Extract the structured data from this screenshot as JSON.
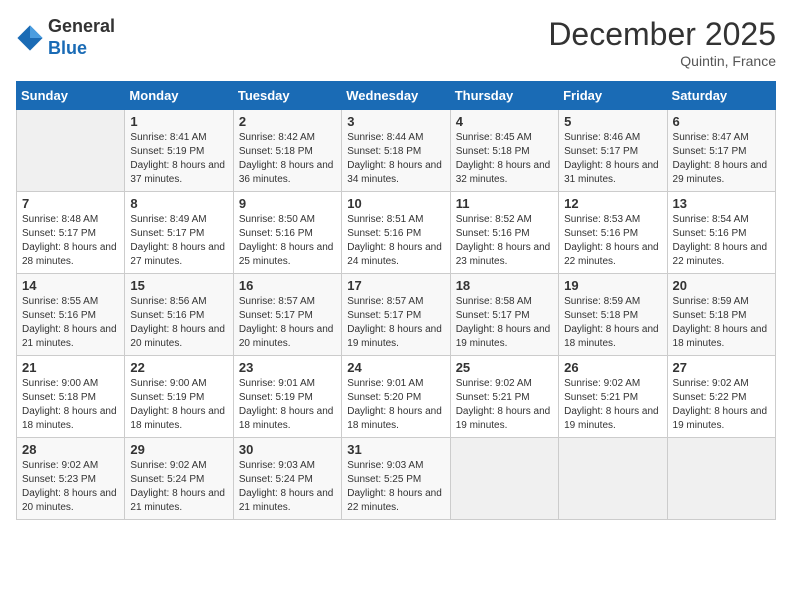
{
  "logo": {
    "general": "General",
    "blue": "Blue"
  },
  "title": {
    "month_year": "December 2025",
    "location": "Quintin, France"
  },
  "days_header": [
    "Sunday",
    "Monday",
    "Tuesday",
    "Wednesday",
    "Thursday",
    "Friday",
    "Saturday"
  ],
  "weeks": [
    [
      {
        "day": "",
        "empty": true
      },
      {
        "day": "1",
        "sunrise": "Sunrise: 8:41 AM",
        "sunset": "Sunset: 5:19 PM",
        "daylight": "Daylight: 8 hours and 37 minutes."
      },
      {
        "day": "2",
        "sunrise": "Sunrise: 8:42 AM",
        "sunset": "Sunset: 5:18 PM",
        "daylight": "Daylight: 8 hours and 36 minutes."
      },
      {
        "day": "3",
        "sunrise": "Sunrise: 8:44 AM",
        "sunset": "Sunset: 5:18 PM",
        "daylight": "Daylight: 8 hours and 34 minutes."
      },
      {
        "day": "4",
        "sunrise": "Sunrise: 8:45 AM",
        "sunset": "Sunset: 5:18 PM",
        "daylight": "Daylight: 8 hours and 32 minutes."
      },
      {
        "day": "5",
        "sunrise": "Sunrise: 8:46 AM",
        "sunset": "Sunset: 5:17 PM",
        "daylight": "Daylight: 8 hours and 31 minutes."
      },
      {
        "day": "6",
        "sunrise": "Sunrise: 8:47 AM",
        "sunset": "Sunset: 5:17 PM",
        "daylight": "Daylight: 8 hours and 29 minutes."
      }
    ],
    [
      {
        "day": "7",
        "sunrise": "Sunrise: 8:48 AM",
        "sunset": "Sunset: 5:17 PM",
        "daylight": "Daylight: 8 hours and 28 minutes."
      },
      {
        "day": "8",
        "sunrise": "Sunrise: 8:49 AM",
        "sunset": "Sunset: 5:17 PM",
        "daylight": "Daylight: 8 hours and 27 minutes."
      },
      {
        "day": "9",
        "sunrise": "Sunrise: 8:50 AM",
        "sunset": "Sunset: 5:16 PM",
        "daylight": "Daylight: 8 hours and 25 minutes."
      },
      {
        "day": "10",
        "sunrise": "Sunrise: 8:51 AM",
        "sunset": "Sunset: 5:16 PM",
        "daylight": "Daylight: 8 hours and 24 minutes."
      },
      {
        "day": "11",
        "sunrise": "Sunrise: 8:52 AM",
        "sunset": "Sunset: 5:16 PM",
        "daylight": "Daylight: 8 hours and 23 minutes."
      },
      {
        "day": "12",
        "sunrise": "Sunrise: 8:53 AM",
        "sunset": "Sunset: 5:16 PM",
        "daylight": "Daylight: 8 hours and 22 minutes."
      },
      {
        "day": "13",
        "sunrise": "Sunrise: 8:54 AM",
        "sunset": "Sunset: 5:16 PM",
        "daylight": "Daylight: 8 hours and 22 minutes."
      }
    ],
    [
      {
        "day": "14",
        "sunrise": "Sunrise: 8:55 AM",
        "sunset": "Sunset: 5:16 PM",
        "daylight": "Daylight: 8 hours and 21 minutes."
      },
      {
        "day": "15",
        "sunrise": "Sunrise: 8:56 AM",
        "sunset": "Sunset: 5:16 PM",
        "daylight": "Daylight: 8 hours and 20 minutes."
      },
      {
        "day": "16",
        "sunrise": "Sunrise: 8:57 AM",
        "sunset": "Sunset: 5:17 PM",
        "daylight": "Daylight: 8 hours and 20 minutes."
      },
      {
        "day": "17",
        "sunrise": "Sunrise: 8:57 AM",
        "sunset": "Sunset: 5:17 PM",
        "daylight": "Daylight: 8 hours and 19 minutes."
      },
      {
        "day": "18",
        "sunrise": "Sunrise: 8:58 AM",
        "sunset": "Sunset: 5:17 PM",
        "daylight": "Daylight: 8 hours and 19 minutes."
      },
      {
        "day": "19",
        "sunrise": "Sunrise: 8:59 AM",
        "sunset": "Sunset: 5:18 PM",
        "daylight": "Daylight: 8 hours and 18 minutes."
      },
      {
        "day": "20",
        "sunrise": "Sunrise: 8:59 AM",
        "sunset": "Sunset: 5:18 PM",
        "daylight": "Daylight: 8 hours and 18 minutes."
      }
    ],
    [
      {
        "day": "21",
        "sunrise": "Sunrise: 9:00 AM",
        "sunset": "Sunset: 5:18 PM",
        "daylight": "Daylight: 8 hours and 18 minutes."
      },
      {
        "day": "22",
        "sunrise": "Sunrise: 9:00 AM",
        "sunset": "Sunset: 5:19 PM",
        "daylight": "Daylight: 8 hours and 18 minutes."
      },
      {
        "day": "23",
        "sunrise": "Sunrise: 9:01 AM",
        "sunset": "Sunset: 5:19 PM",
        "daylight": "Daylight: 8 hours and 18 minutes."
      },
      {
        "day": "24",
        "sunrise": "Sunrise: 9:01 AM",
        "sunset": "Sunset: 5:20 PM",
        "daylight": "Daylight: 8 hours and 18 minutes."
      },
      {
        "day": "25",
        "sunrise": "Sunrise: 9:02 AM",
        "sunset": "Sunset: 5:21 PM",
        "daylight": "Daylight: 8 hours and 19 minutes."
      },
      {
        "day": "26",
        "sunrise": "Sunrise: 9:02 AM",
        "sunset": "Sunset: 5:21 PM",
        "daylight": "Daylight: 8 hours and 19 minutes."
      },
      {
        "day": "27",
        "sunrise": "Sunrise: 9:02 AM",
        "sunset": "Sunset: 5:22 PM",
        "daylight": "Daylight: 8 hours and 19 minutes."
      }
    ],
    [
      {
        "day": "28",
        "sunrise": "Sunrise: 9:02 AM",
        "sunset": "Sunset: 5:23 PM",
        "daylight": "Daylight: 8 hours and 20 minutes."
      },
      {
        "day": "29",
        "sunrise": "Sunrise: 9:02 AM",
        "sunset": "Sunset: 5:24 PM",
        "daylight": "Daylight: 8 hours and 21 minutes."
      },
      {
        "day": "30",
        "sunrise": "Sunrise: 9:03 AM",
        "sunset": "Sunset: 5:24 PM",
        "daylight": "Daylight: 8 hours and 21 minutes."
      },
      {
        "day": "31",
        "sunrise": "Sunrise: 9:03 AM",
        "sunset": "Sunset: 5:25 PM",
        "daylight": "Daylight: 8 hours and 22 minutes."
      },
      {
        "day": "",
        "empty": true
      },
      {
        "day": "",
        "empty": true
      },
      {
        "day": "",
        "empty": true
      }
    ]
  ]
}
